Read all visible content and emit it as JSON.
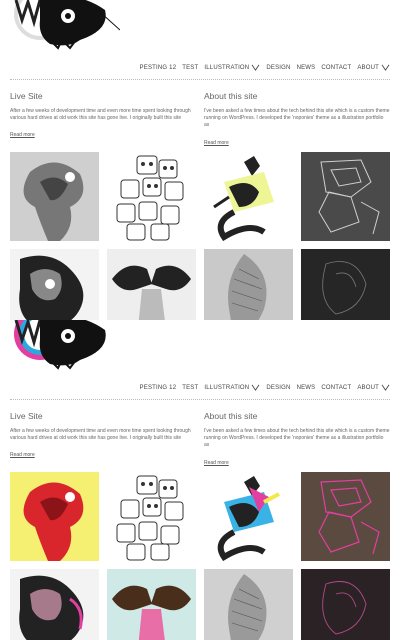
{
  "nav": {
    "items": [
      {
        "label": "PESTING 12",
        "has_submenu": false
      },
      {
        "label": "TEST",
        "has_submenu": false
      },
      {
        "label": "ILLUSTRATION",
        "has_submenu": true
      },
      {
        "label": "DESIGN",
        "has_submenu": false
      },
      {
        "label": "NEWS",
        "has_submenu": false
      },
      {
        "label": "CONTACT",
        "has_submenu": false
      },
      {
        "label": "ABOUT",
        "has_submenu": true
      }
    ]
  },
  "posts": [
    {
      "title": "Live Site",
      "excerpt": "After a few weeks of development time and even more time spent looking through various hard drives at old work this site has gone live. I originally built this site",
      "read_more": "Read more"
    },
    {
      "title": "About this site",
      "excerpt": "I've been asked a few times about the tech behind this site which is a custom theme running on WordPress. I developed the 'noponies' theme as a illustration portfolio as",
      "read_more": "Read more"
    }
  ],
  "colors": {
    "background": "#ffffff",
    "nav_text": "#444444",
    "body_text": "#666666",
    "rule": "#bbbbbb"
  },
  "frames": [
    {
      "variant": "monochrome"
    },
    {
      "variant": "color"
    }
  ]
}
